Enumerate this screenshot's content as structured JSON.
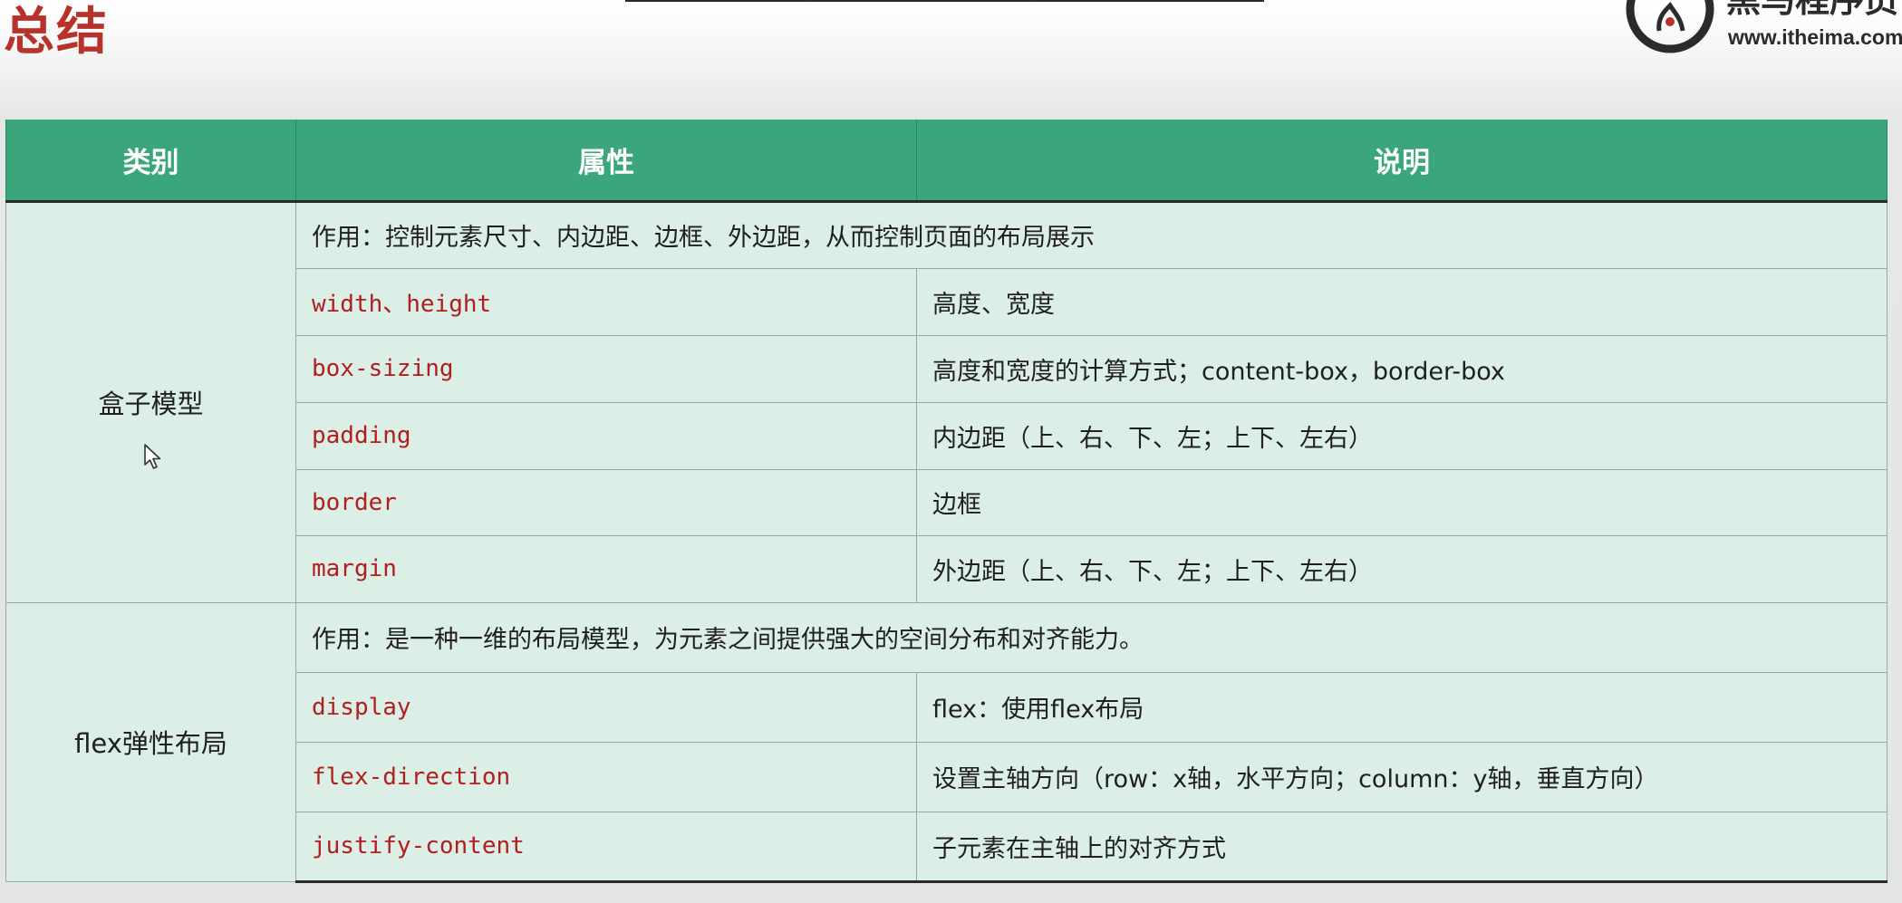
{
  "title": "总结",
  "logo": {
    "name": "黑马程序员",
    "url": "www.itheima.com"
  },
  "table": {
    "headers": [
      "类别",
      "属性",
      "说明"
    ],
    "groups": [
      {
        "category": "盒子模型",
        "purpose": "作用：控制元素尺寸、内边距、边框、外边距，从而控制页面的布局展示",
        "rows": [
          {
            "property": "width、height",
            "description": "高度、宽度"
          },
          {
            "property": "box-sizing",
            "description": "高度和宽度的计算方式；content-box，border-box"
          },
          {
            "property": "padding",
            "description": "内边距（上、右、下、左；上下、左右）"
          },
          {
            "property": "border",
            "description": "边框"
          },
          {
            "property": "margin",
            "description": "外边距（上、右、下、左；上下、左右）"
          }
        ]
      },
      {
        "category": "flex弹性布局",
        "purpose": "作用：是一种一维的布局模型，为元素之间提供强大的空间分布和对齐能力。",
        "rows": [
          {
            "property": "display",
            "description": "flex：使用flex布局"
          },
          {
            "property": "flex-direction",
            "description": "设置主轴方向（row：x轴，水平方向；column：y轴，垂直方向）"
          },
          {
            "property": "justify-content",
            "description": "子元素在主轴上的对齐方式"
          }
        ]
      }
    ]
  },
  "colors": {
    "title": "#b8322b",
    "header_bg": "#3ba67c",
    "body_bg": "#dcefe7",
    "property_text": "#b01e1e"
  }
}
